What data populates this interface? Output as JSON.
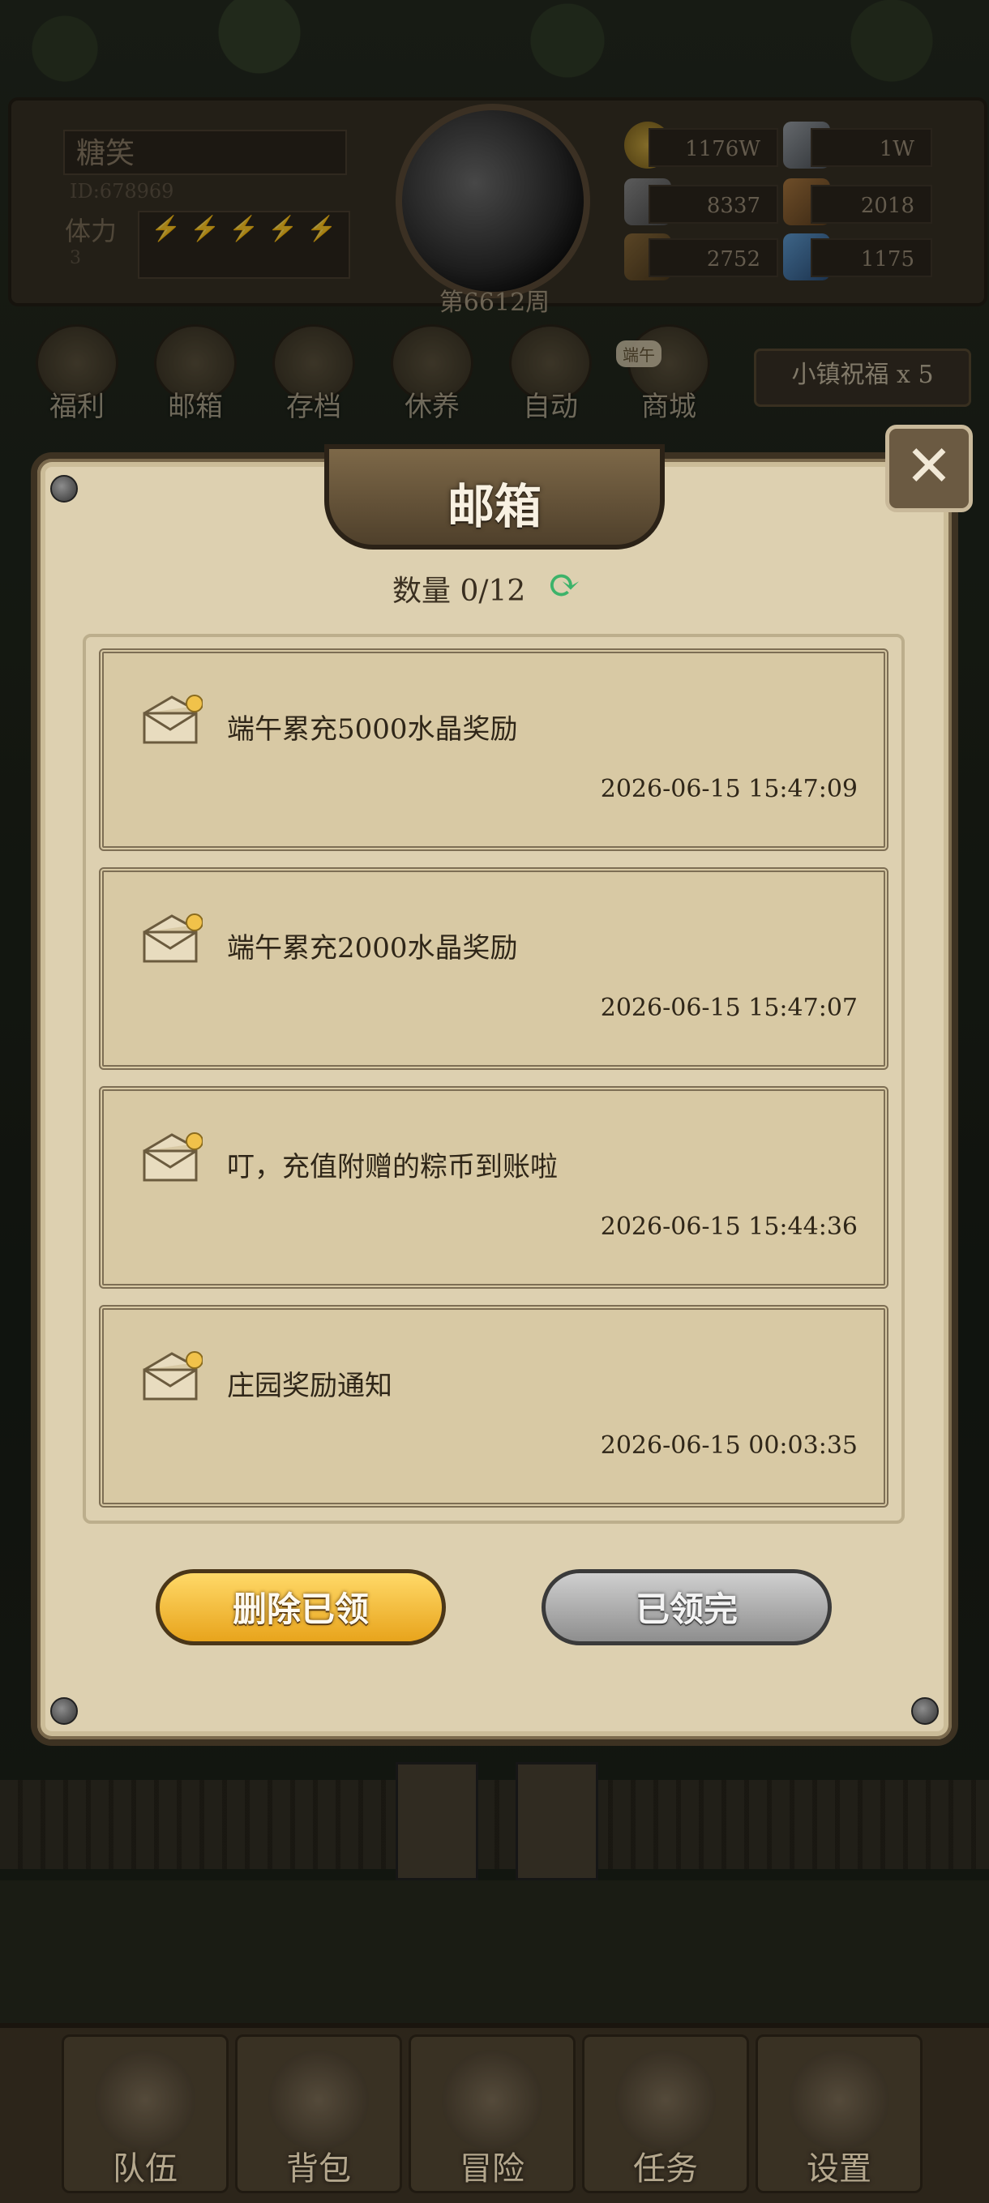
{
  "hud": {
    "player_name": "糖笑",
    "player_id": "ID:678969",
    "stamina_label": "体力",
    "stamina_value": "3",
    "week_label": "第6612周",
    "resources": {
      "gold": "1176W",
      "iron": "1W",
      "stone": "8337",
      "leather": "2018",
      "wood": "2752",
      "crystal": "1175"
    }
  },
  "shortcuts": [
    {
      "label": "福利",
      "icon": "shield-wheel-icon"
    },
    {
      "label": "邮箱",
      "icon": "mail-icon"
    },
    {
      "label": "存档",
      "icon": "scroll-icon"
    },
    {
      "label": "休养",
      "icon": "bed-icon"
    },
    {
      "label": "自动",
      "icon": "book-icon"
    },
    {
      "label": "商城",
      "icon": "shop-icon"
    }
  ],
  "event_tag": "端午",
  "blessing": "小镇祝福 x 5",
  "mailbox": {
    "title": "邮箱",
    "count": "数量 0/12",
    "mails": [
      {
        "title": "端午累充5000水晶奖励",
        "time": "2026-06-15  15:47:09"
      },
      {
        "title": "端午累充2000水晶奖励",
        "time": "2026-06-15  15:47:07"
      },
      {
        "title": "叮，充值附赠的粽币到账啦",
        "time": "2026-06-15  15:44:36"
      },
      {
        "title": "庄园奖励通知",
        "time": "2026-06-15  00:03:35"
      }
    ],
    "delete_button": "删除已领",
    "claimed_button": "已领完"
  },
  "bottom_nav": [
    {
      "label": "队伍"
    },
    {
      "label": "背包"
    },
    {
      "label": "冒险"
    },
    {
      "label": "任务"
    },
    {
      "label": "设置"
    }
  ],
  "colors": {
    "panel": "#ddd0b0",
    "panel_border": "#3d3222",
    "button_yellow": "#e8a41c",
    "button_gray": "#8e8e8e",
    "unread_dot": "#f1c24a"
  }
}
